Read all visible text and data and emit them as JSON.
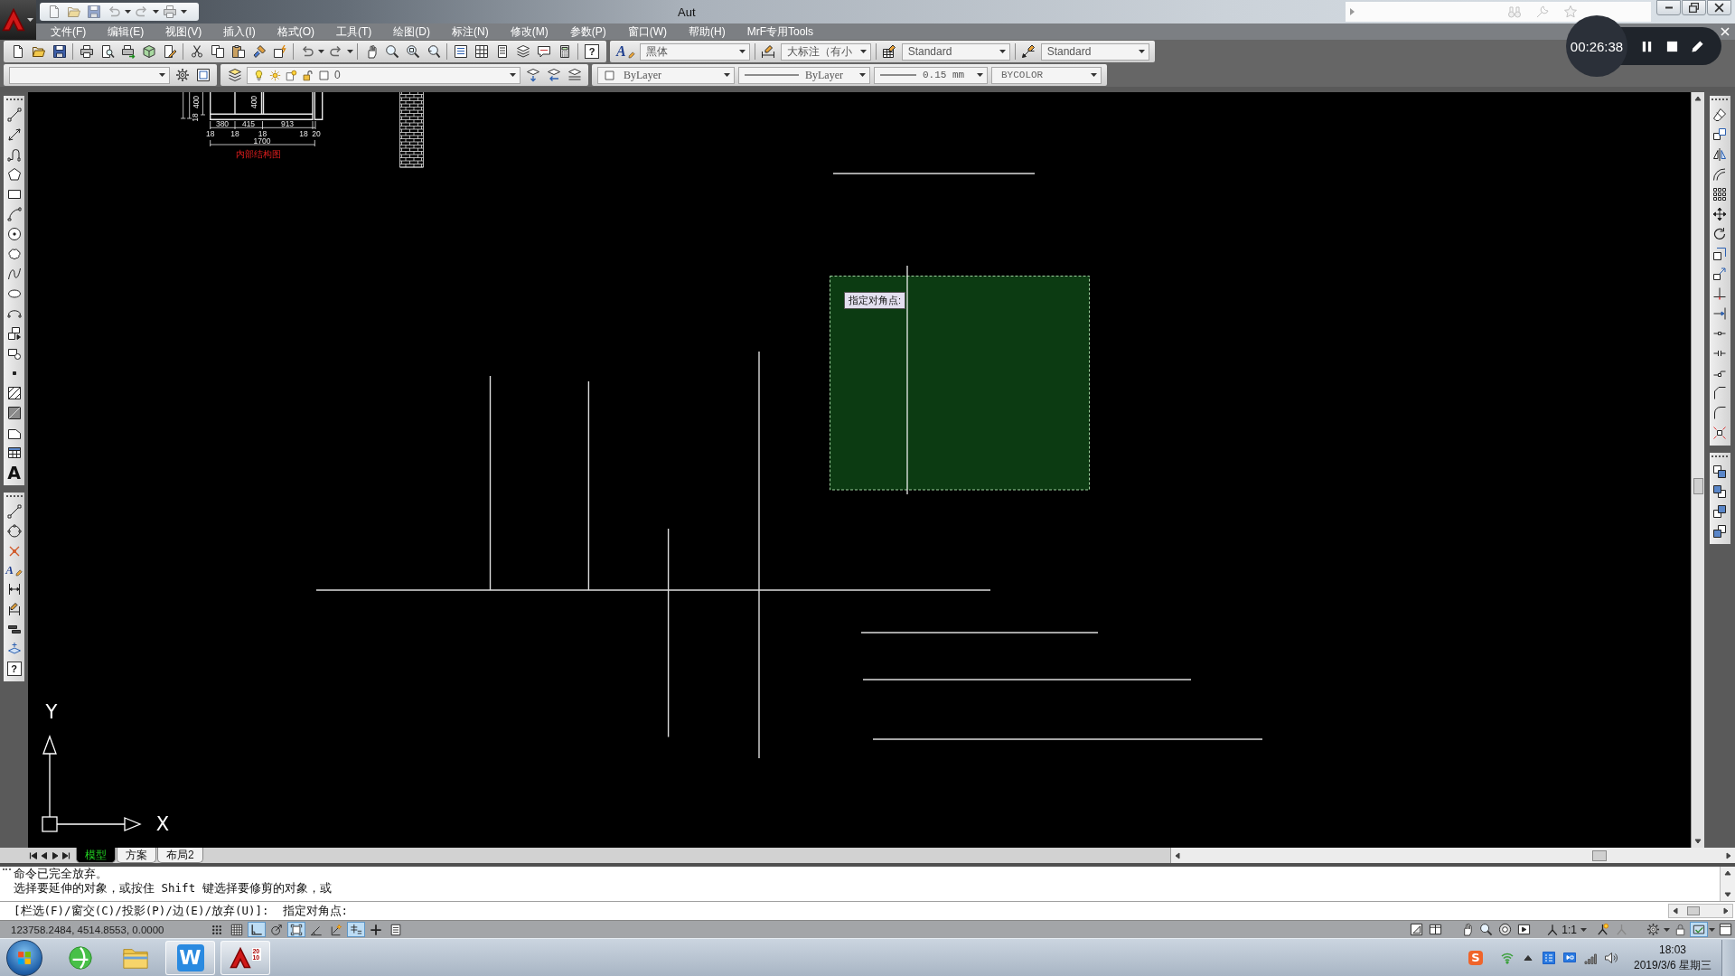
{
  "title_bar": {
    "title": "Aut"
  },
  "menu_bar": {
    "items": [
      "文件(F)",
      "编辑(E)",
      "视图(V)",
      "插入(I)",
      "格式(O)",
      "工具(T)",
      "绘图(D)",
      "标注(N)",
      "修改(M)",
      "参数(P)",
      "窗口(W)",
      "帮助(H)",
      "MrF专用Tools"
    ]
  },
  "standard_toolbar": {
    "help_glyph": "?"
  },
  "styles_toolbar": {
    "text_style_glyph": "A",
    "text_style": "黑体",
    "dimension_style": "大标注（有小",
    "table_style": "Standard",
    "multileader_style": "Standard"
  },
  "layers_toolbar": {
    "current_layer": "0"
  },
  "properties_toolbar": {
    "color_setting": "ByLayer",
    "linetype": "ByLayer",
    "lineweight": "0.15 mm",
    "plot_style": "BYCOLOR"
  },
  "screen_recorder": {
    "elapsed": "00:26:38"
  },
  "draw_toolbar": {
    "text_glyph": "A"
  },
  "annotate_toolbar": {
    "text_glyph": "A",
    "help_glyph": "?"
  },
  "drawing": {
    "detail": {
      "segment_dims": [
        "380",
        "415",
        "913"
      ],
      "gap_dims": [
        "18",
        "18",
        "18",
        "18",
        "20"
      ],
      "overall_dim": "1700",
      "height_dims": [
        "400",
        "18",
        "400"
      ],
      "caption": "内部结构图"
    },
    "tooltip": "指定对角点:",
    "ucs": {
      "y_label": "Y",
      "x_label": "X"
    }
  },
  "layout_tabs": [
    {
      "label": "模型",
      "selected": true
    },
    {
      "label": "方案",
      "selected": false
    },
    {
      "label": "布局2",
      "selected": false
    }
  ],
  "command_window": {
    "history": [
      "命令已完全放弃。",
      "选择要延伸的对象，或按住 Shift 键选择要修剪的对象，或"
    ],
    "prompt": "[栏选(F)/窗交(C)/投影(P)/边(E)/放弃(U)]:  指定对角点:"
  },
  "status_bar": {
    "coordinates": "123758.2484, 4514.8553, 0.0000",
    "toggles": [
      {
        "on": false
      },
      {
        "on": false
      },
      {
        "on": true
      },
      {
        "on": false
      },
      {
        "on": true
      },
      {
        "on": false
      },
      {
        "on": false
      },
      {
        "on": true
      },
      {
        "on": false
      },
      {
        "on": false
      }
    ],
    "annotation_scale": "1:1"
  },
  "taskbar": {
    "apps": [
      {
        "kind": "browser",
        "running": false
      },
      {
        "kind": "folder",
        "running": false
      },
      {
        "kind": "wps",
        "glyph": "W",
        "running": true
      },
      {
        "kind": "autocad",
        "version": "2010",
        "running": true
      }
    ],
    "tray_glyph": "S",
    "clock": {
      "time": "18:03",
      "date": "2019/3/6 星期三"
    }
  }
}
